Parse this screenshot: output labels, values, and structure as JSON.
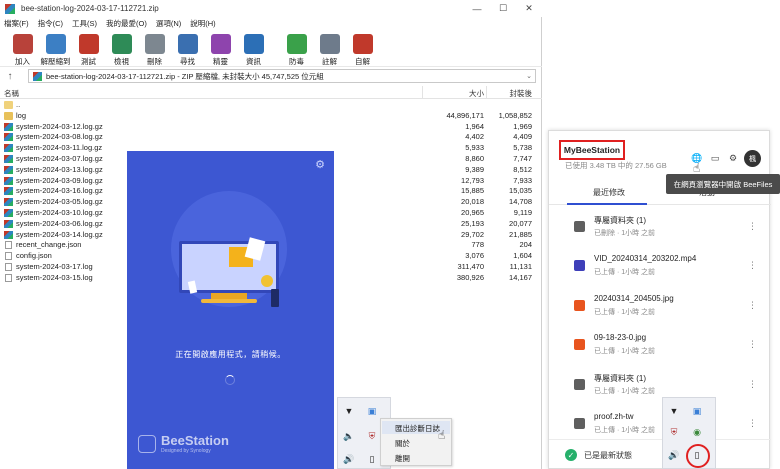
{
  "winrar": {
    "title": "bee-station-log-2024-03-17-112721.zip",
    "controls": {
      "minimize": "—",
      "maximize": "☐",
      "close": "✕"
    },
    "menu": [
      "檔案(F)",
      "指令(C)",
      "工具(S)",
      "我的最愛(O)",
      "選項(N)",
      "說明(H)"
    ],
    "toolbar": [
      {
        "label": "加入",
        "icon": "add-archive-icon",
        "color": "#b8423a"
      },
      {
        "label": "解壓縮到",
        "icon": "extract-folder-icon",
        "color": "#3c7fc4"
      },
      {
        "label": "測試",
        "icon": "test-clipboard-icon",
        "color": "#c0392b"
      },
      {
        "label": "檢視",
        "icon": "view-book-icon",
        "color": "#2e8b57"
      },
      {
        "label": "刪除",
        "icon": "delete-trash-icon",
        "color": "#7d8790"
      },
      {
        "label": "尋找",
        "icon": "find-magnifier-icon",
        "color": "#3a6fb0"
      },
      {
        "label": "精靈",
        "icon": "wizard-wand-icon",
        "color": "#8e44ad"
      },
      {
        "label": "資訊",
        "icon": "info-icon",
        "color": "#2c6fb6"
      },
      {
        "label": "防毒",
        "icon": "antivirus-icon",
        "color": "#3aa14a"
      },
      {
        "label": "註解",
        "icon": "comment-icon",
        "color": "#6e7b8b"
      },
      {
        "label": "自解",
        "icon": "sfx-icon",
        "color": "#c0392b"
      }
    ],
    "address": "bee-station-log-2024-03-17-112721.zip - ZIP 壓縮檔, 未封裝大小 45,747,525 位元組",
    "columns": {
      "name": "名稱",
      "size": "大小",
      "packed": "封裝後"
    },
    "files": [
      {
        "name": "..",
        "size": "",
        "packed": "",
        "type": "up"
      },
      {
        "name": "log",
        "size": "44,896,171",
        "packed": "1,058,852",
        "type": "folder"
      },
      {
        "name": "system-2024-03-12.log.gz",
        "size": "1,964",
        "packed": "1,969",
        "type": "gz"
      },
      {
        "name": "system-2024-03-08.log.gz",
        "size": "4,402",
        "packed": "4,409",
        "type": "gz"
      },
      {
        "name": "system-2024-03-11.log.gz",
        "size": "5,933",
        "packed": "5,738",
        "type": "gz"
      },
      {
        "name": "system-2024-03-07.log.gz",
        "size": "8,860",
        "packed": "7,747",
        "type": "gz"
      },
      {
        "name": "system-2024-03-13.log.gz",
        "size": "9,389",
        "packed": "8,512",
        "type": "gz"
      },
      {
        "name": "system-2024-03-09.log.gz",
        "size": "12,793",
        "packed": "7,933",
        "type": "gz"
      },
      {
        "name": "system-2024-03-16.log.gz",
        "size": "15,885",
        "packed": "15,035",
        "type": "gz"
      },
      {
        "name": "system-2024-03-05.log.gz",
        "size": "20,018",
        "packed": "14,708",
        "type": "gz"
      },
      {
        "name": "system-2024-03-10.log.gz",
        "size": "20,965",
        "packed": "9,119",
        "type": "gz"
      },
      {
        "name": "system-2024-03-06.log.gz",
        "size": "25,193",
        "packed": "20,077",
        "type": "gz"
      },
      {
        "name": "system-2024-03-14.log.gz",
        "size": "29,702",
        "packed": "21,885",
        "type": "gz"
      },
      {
        "name": "recent_change.json",
        "size": "778",
        "packed": "204",
        "type": "doc"
      },
      {
        "name": "config.json",
        "size": "3,076",
        "packed": "1,604",
        "type": "doc"
      },
      {
        "name": "system-2024-03-17.log",
        "size": "311,470",
        "packed": "11,131",
        "type": "doc"
      },
      {
        "name": "system-2024-03-15.log",
        "size": "380,926",
        "packed": "14,167",
        "type": "doc"
      }
    ]
  },
  "splash": {
    "message": "正在開啟應用程式，請稍候。",
    "brand": "BeeStation",
    "brand_sub": "Designed by Synology",
    "bg_color": "#3d57d2"
  },
  "tray_left": {
    "context_menu": [
      "匯出診斷日誌",
      "關於",
      "離開"
    ]
  },
  "panel": {
    "device_name": "MyBeeStation",
    "usage": "已使用 3.48 TB 中的 27.56 GB",
    "avatar": "楓",
    "tooltip": "在網頁瀏覽器中開啟 BeeFiles",
    "tabs": [
      "最近修改",
      "活動"
    ],
    "items": [
      {
        "name": "專屬資料夾 (1)",
        "meta": "已刪除 · 1小時 之前",
        "type": "folder"
      },
      {
        "name": "VID_20240314_203202.mp4",
        "meta": "已上傳 · 1小時 之前",
        "type": "video"
      },
      {
        "name": "20240314_204505.jpg",
        "meta": "已上傳 · 1小時 之前",
        "type": "image"
      },
      {
        "name": "09-18-23-0.jpg",
        "meta": "已上傳 · 1小時 之前",
        "type": "image"
      },
      {
        "name": "專屬資料夾 (1)",
        "meta": "已上傳 · 1小時 之前",
        "type": "folder"
      },
      {
        "name": "proof.zh-tw",
        "meta": "已上傳 · 1小時 之前",
        "type": "folder"
      }
    ],
    "status": "已是最新狀態",
    "accent": "#2f4fd1"
  }
}
